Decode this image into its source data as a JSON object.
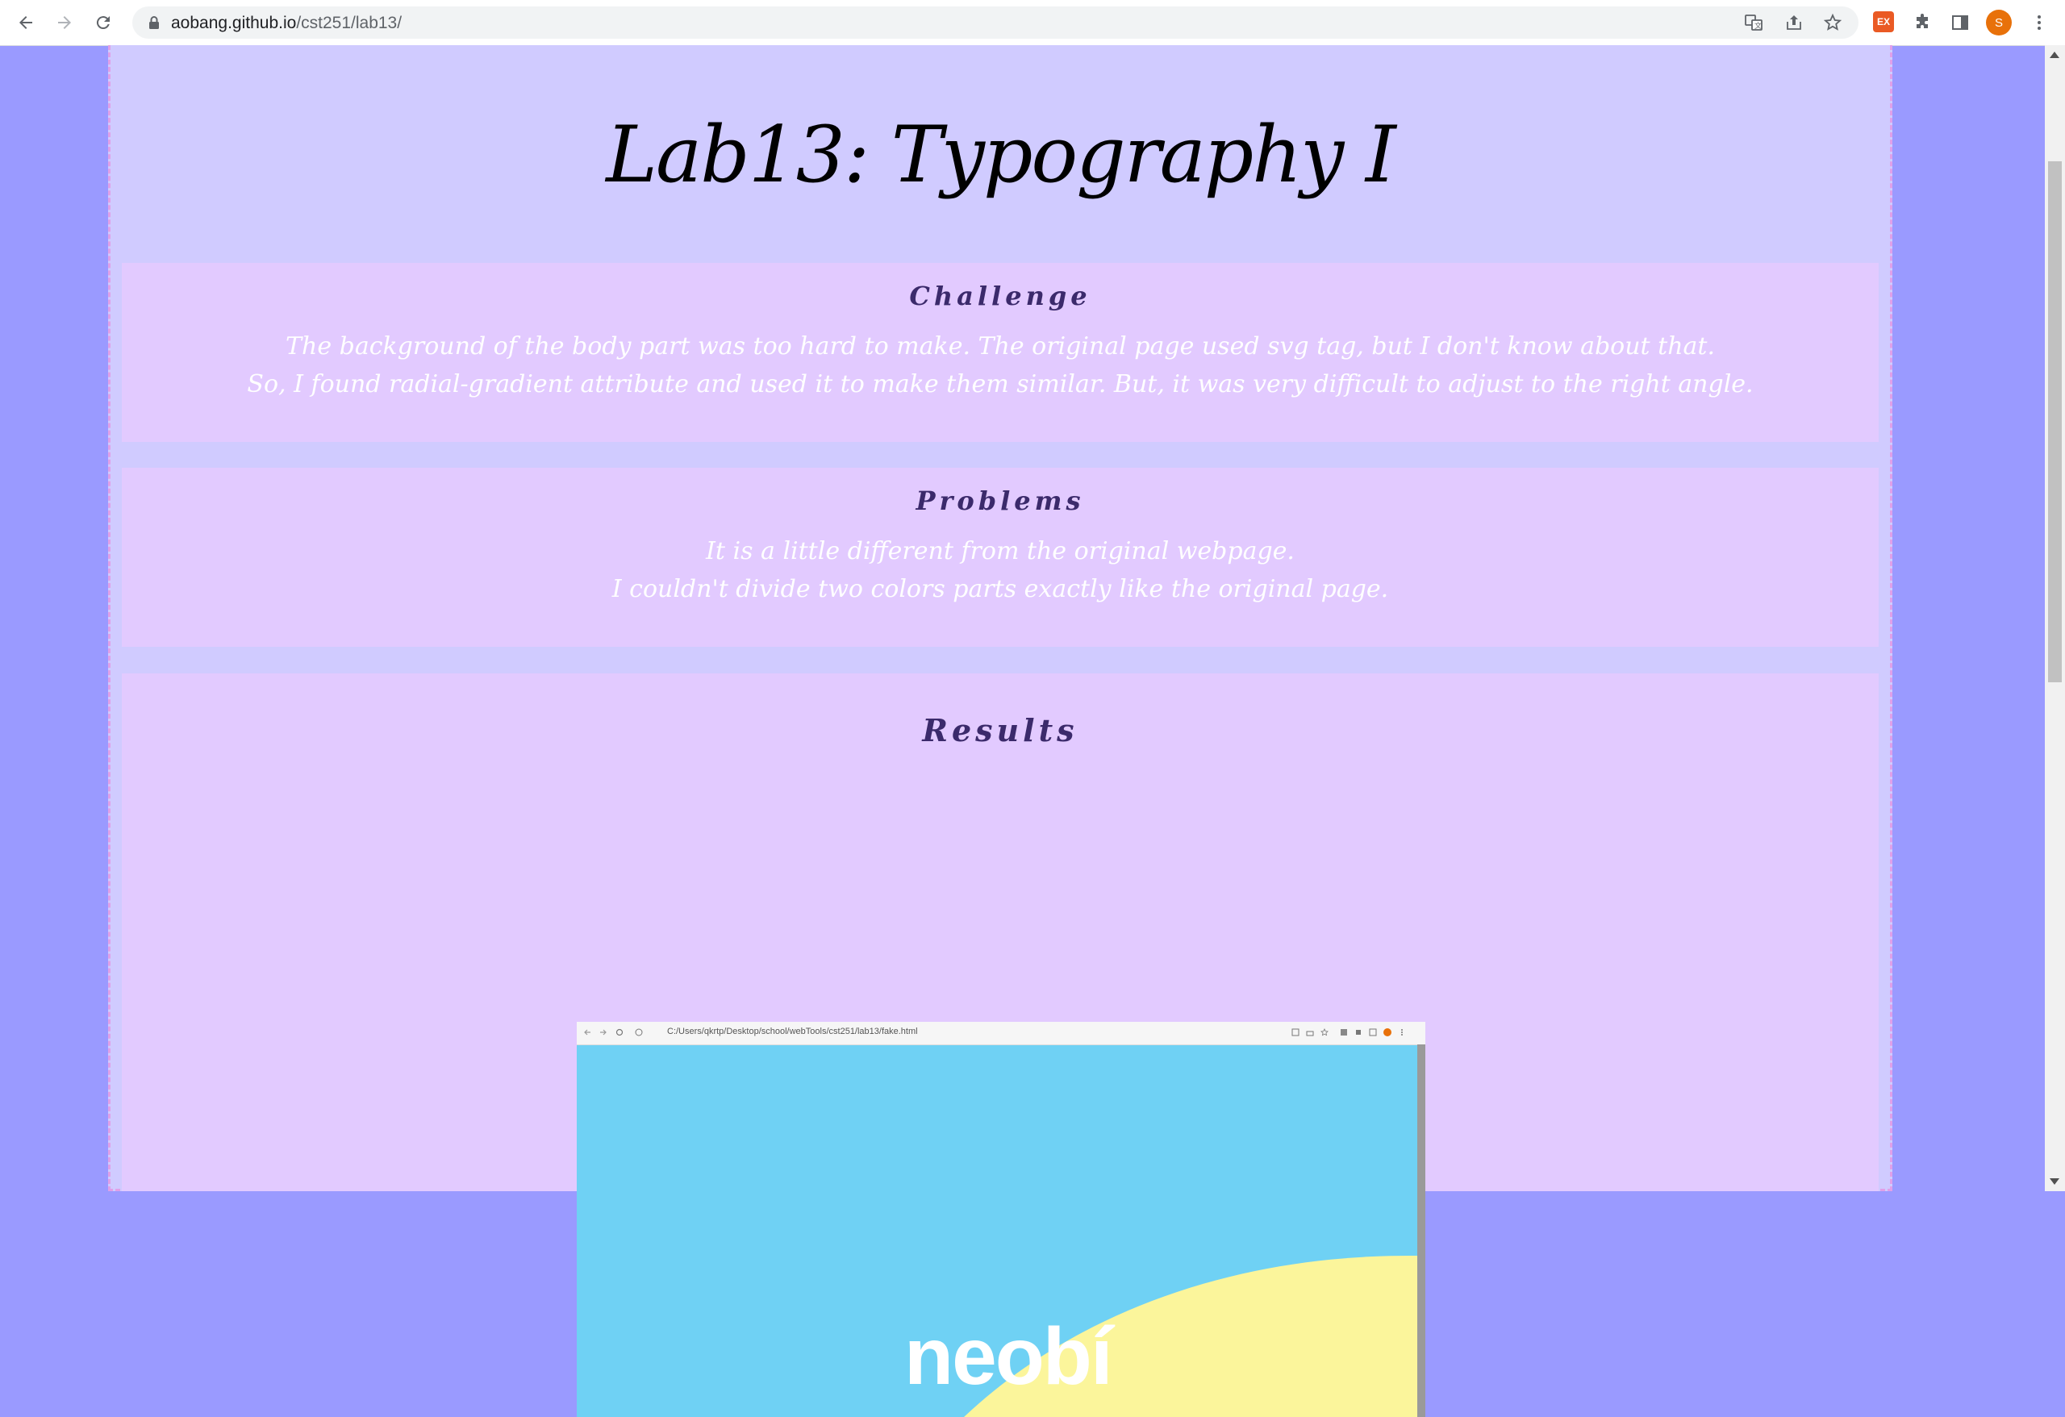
{
  "browser": {
    "url_host": "aobang.github.io",
    "url_path": "/cst251/lab13/",
    "avatar_letter": "S",
    "ext_badge": "EX"
  },
  "page": {
    "title": "Lab13: Typography I",
    "challenge": {
      "heading": "Challenge",
      "lines": [
        "The background of the body part was too hard to make. The original page used svg tag, but I don't know about that.",
        "So, I found radial-gradient attribute and used it to make them similar. But, it was very difficult to adjust to the right angle."
      ]
    },
    "problems": {
      "heading": "Problems",
      "lines": [
        "It is a little different from the original webpage.",
        "I couldn't divide two colors parts exactly like the original page."
      ]
    },
    "results": {
      "heading": "Results",
      "screenshot": {
        "url": "C:/Users/qkrtp/Desktop/school/webTools/cst251/lab13/fake.html",
        "logo": "neobí"
      }
    }
  },
  "colors": {
    "outer_bg": "#9a9aff",
    "frame_bg": "#d0cbff",
    "section_bg": "#e2caff",
    "heading": "#3b2a6b",
    "sky": "#6fd1f4",
    "sand": "#fbf59b"
  }
}
